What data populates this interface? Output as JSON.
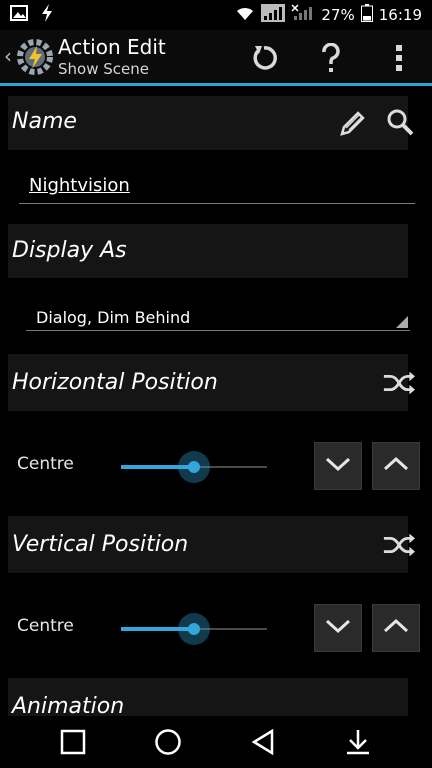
{
  "status": {
    "battery_percent": "27%",
    "time": "16:19"
  },
  "actionbar": {
    "title": "Action Edit",
    "subtitle": "Show Scene"
  },
  "name_section": {
    "label": "Name",
    "value": "Nightvision"
  },
  "display_section": {
    "label": "Display As",
    "selected": "Dialog, Dim Behind"
  },
  "horizontal_section": {
    "label": "Horizontal Position",
    "value_label": "Centre",
    "level": 0.5
  },
  "vertical_section": {
    "label": "Vertical Position",
    "value_label": "Centre",
    "level": 0.5
  },
  "animation_section": {
    "label": "Animation"
  },
  "colors": {
    "accent": "#33a6de",
    "section_bg": "#151515"
  }
}
